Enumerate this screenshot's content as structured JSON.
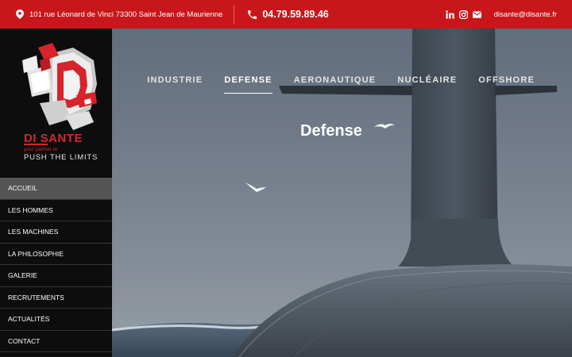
{
  "topbar": {
    "address": "101 rue Léonard de Vinci 73300 Saint Jean de Maurienne",
    "phone": "04.79.59.89.46",
    "email": "disante@disante.fr",
    "icons": [
      "location-pin-icon",
      "phone-icon",
      "linkedin-icon",
      "instagram-icon",
      "mail-icon"
    ],
    "bg_color": "#c8161b"
  },
  "logo": {
    "brand": "DI SANTE",
    "tagline_small": "your partner to",
    "tagline_big": "PUSH THE LIMITS",
    "color": "#d4282c"
  },
  "sidebar": {
    "items": [
      {
        "label": "Accueil",
        "active": true
      },
      {
        "label": "Les hommes",
        "active": false
      },
      {
        "label": "Les machines",
        "active": false
      },
      {
        "label": "La philosophie",
        "active": false
      },
      {
        "label": "Galerie",
        "active": false
      },
      {
        "label": "Recrutements",
        "active": false
      },
      {
        "label": "Actualités",
        "active": false
      },
      {
        "label": "Contact",
        "active": false
      }
    ]
  },
  "nav": {
    "items": [
      {
        "label": "Industrie",
        "current": false
      },
      {
        "label": "Defense",
        "current": true
      },
      {
        "label": "Aeronautique",
        "current": false
      },
      {
        "label": "Nucléaire",
        "current": false
      },
      {
        "label": "Offshore",
        "current": false
      }
    ]
  },
  "hero": {
    "title": "Defense"
  }
}
